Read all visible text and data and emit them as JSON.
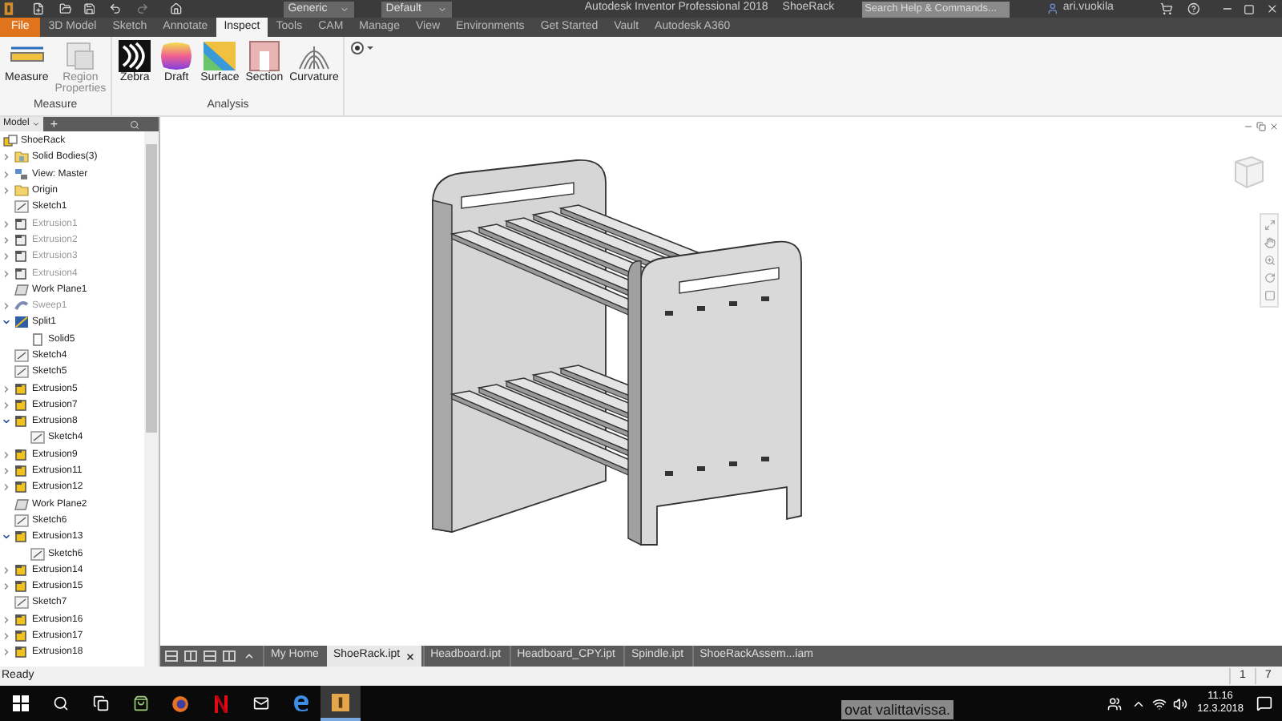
{
  "title_bar": {
    "material": "Generic",
    "appearance": "Default",
    "title": "Autodesk Inventor Professional 2018",
    "document": "ShoeRack",
    "search": {
      "placeholder": "Search Help & Commands..."
    },
    "user": "ari.vuokila"
  },
  "ribbon_tabs": [
    {
      "label": "File",
      "kind": "file",
      "selected": false
    },
    {
      "label": "3D Model",
      "kind": "tab",
      "selected": false
    },
    {
      "label": "Sketch",
      "kind": "tab",
      "selected": false
    },
    {
      "label": "Annotate",
      "kind": "tab",
      "selected": false
    },
    {
      "label": "Inspect",
      "kind": "tab",
      "selected": true
    },
    {
      "label": "Tools",
      "kind": "tab",
      "selected": false
    },
    {
      "label": "CAM",
      "kind": "tab",
      "selected": false
    },
    {
      "label": "Manage",
      "kind": "tab",
      "selected": false
    },
    {
      "label": "View",
      "kind": "tab",
      "selected": false
    },
    {
      "label": "Environments",
      "kind": "tab",
      "selected": false
    },
    {
      "label": "Get Started",
      "kind": "tab",
      "selected": false
    },
    {
      "label": "Vault",
      "kind": "tab",
      "selected": false
    },
    {
      "label": "Autodesk A360",
      "kind": "tab",
      "selected": false
    }
  ],
  "ribbon_panels": [
    {
      "label": "Measure",
      "buttons": [
        {
          "label": "Measure",
          "kind": "measure",
          "disabled": false
        },
        {
          "label": "Region Properties",
          "kind": "region",
          "disabled": true
        }
      ]
    },
    {
      "label": "Analysis",
      "buttons": [
        {
          "label": "Zebra",
          "kind": "zebra",
          "disabled": false
        },
        {
          "label": "Draft",
          "kind": "draft",
          "disabled": false
        },
        {
          "label": "Surface",
          "kind": "surface",
          "disabled": false
        },
        {
          "label": "Section",
          "kind": "section",
          "disabled": false
        },
        {
          "label": "Curvature",
          "kind": "curvature",
          "disabled": false
        }
      ]
    }
  ],
  "browser": {
    "tab": "Model",
    "add_tab": "+"
  },
  "tree": {
    "root": "ShoeRack",
    "items": [
      {
        "label": "Solid Bodies(3)",
        "kind": "solids",
        "disabled": false,
        "expanded": false
      },
      {
        "label": "View: Master",
        "kind": "view",
        "disabled": false,
        "expanded": false
      },
      {
        "label": "Origin",
        "kind": "folder",
        "disabled": false,
        "expanded": false
      },
      {
        "label": "Sketch1",
        "kind": "sketch",
        "disabled": false
      },
      {
        "label": "Extrusion1",
        "kind": "extrusion",
        "disabled": true,
        "expanded": false
      },
      {
        "label": "Extrusion2",
        "kind": "extrusion",
        "disabled": true,
        "expanded": false
      },
      {
        "label": "Extrusion3",
        "kind": "extrusion",
        "disabled": true,
        "expanded": false
      },
      {
        "label": "Extrusion4",
        "kind": "extrusion",
        "disabled": true,
        "expanded": false
      },
      {
        "label": "Work Plane1",
        "kind": "plane",
        "disabled": false
      },
      {
        "label": "Sweep1",
        "kind": "sweep",
        "disabled": true,
        "expanded": false
      },
      {
        "label": "Split1",
        "kind": "split",
        "disabled": false,
        "expanded": true,
        "children": [
          {
            "label": "Solid5",
            "kind": "solid",
            "disabled": false
          }
        ]
      },
      {
        "label": "Sketch4",
        "kind": "sketch",
        "disabled": false
      },
      {
        "label": "Sketch5",
        "kind": "sketch",
        "disabled": false
      },
      {
        "label": "Extrusion5",
        "kind": "extrusion",
        "disabled": false,
        "expanded": false
      },
      {
        "label": "Extrusion7",
        "kind": "extrusion",
        "disabled": false,
        "expanded": false
      },
      {
        "label": "Extrusion8",
        "kind": "extrusion",
        "disabled": false,
        "expanded": true,
        "children": [
          {
            "label": "Sketch4",
            "kind": "sketch",
            "disabled": false
          }
        ]
      },
      {
        "label": "Extrusion9",
        "kind": "extrusion",
        "disabled": false,
        "expanded": false
      },
      {
        "label": "Extrusion11",
        "kind": "extrusion",
        "disabled": false,
        "expanded": false
      },
      {
        "label": "Extrusion12",
        "kind": "extrusion",
        "disabled": false,
        "expanded": false
      },
      {
        "label": "Work Plane2",
        "kind": "plane",
        "disabled": false
      },
      {
        "label": "Sketch6",
        "kind": "sketch",
        "disabled": false
      },
      {
        "label": "Extrusion13",
        "kind": "extrusion",
        "disabled": false,
        "expanded": true,
        "children": [
          {
            "label": "Sketch6",
            "kind": "sketch",
            "disabled": false
          }
        ]
      },
      {
        "label": "Extrusion14",
        "kind": "extrusion",
        "disabled": false,
        "expanded": false
      },
      {
        "label": "Extrusion15",
        "kind": "extrusion",
        "disabled": false,
        "expanded": false
      },
      {
        "label": "Sketch7",
        "kind": "sketch",
        "disabled": false
      },
      {
        "label": "Extrusion16",
        "kind": "extrusion",
        "disabled": false,
        "expanded": false
      },
      {
        "label": "Extrusion17",
        "kind": "extrusion",
        "disabled": false,
        "expanded": false
      },
      {
        "label": "Extrusion18",
        "kind": "extrusion",
        "disabled": false,
        "expanded": false
      }
    ]
  },
  "document_tabs": [
    {
      "label": "My Home",
      "selected": false
    },
    {
      "label": "ShoeRack.ipt",
      "selected": true
    },
    {
      "label": "Headboard.ipt",
      "selected": false
    },
    {
      "label": "Headboard_CPY.ipt",
      "selected": false
    },
    {
      "label": "Spindle.ipt",
      "selected": false
    },
    {
      "label": "ShoeRackAssem...iam",
      "selected": false
    }
  ],
  "status_bar": {
    "text": "Ready",
    "count_1": "1",
    "count_2": "7"
  },
  "taskbar": {
    "overlay_text": "ovat valittavissa.",
    "time": "11.16",
    "date": "12.3.2018"
  }
}
